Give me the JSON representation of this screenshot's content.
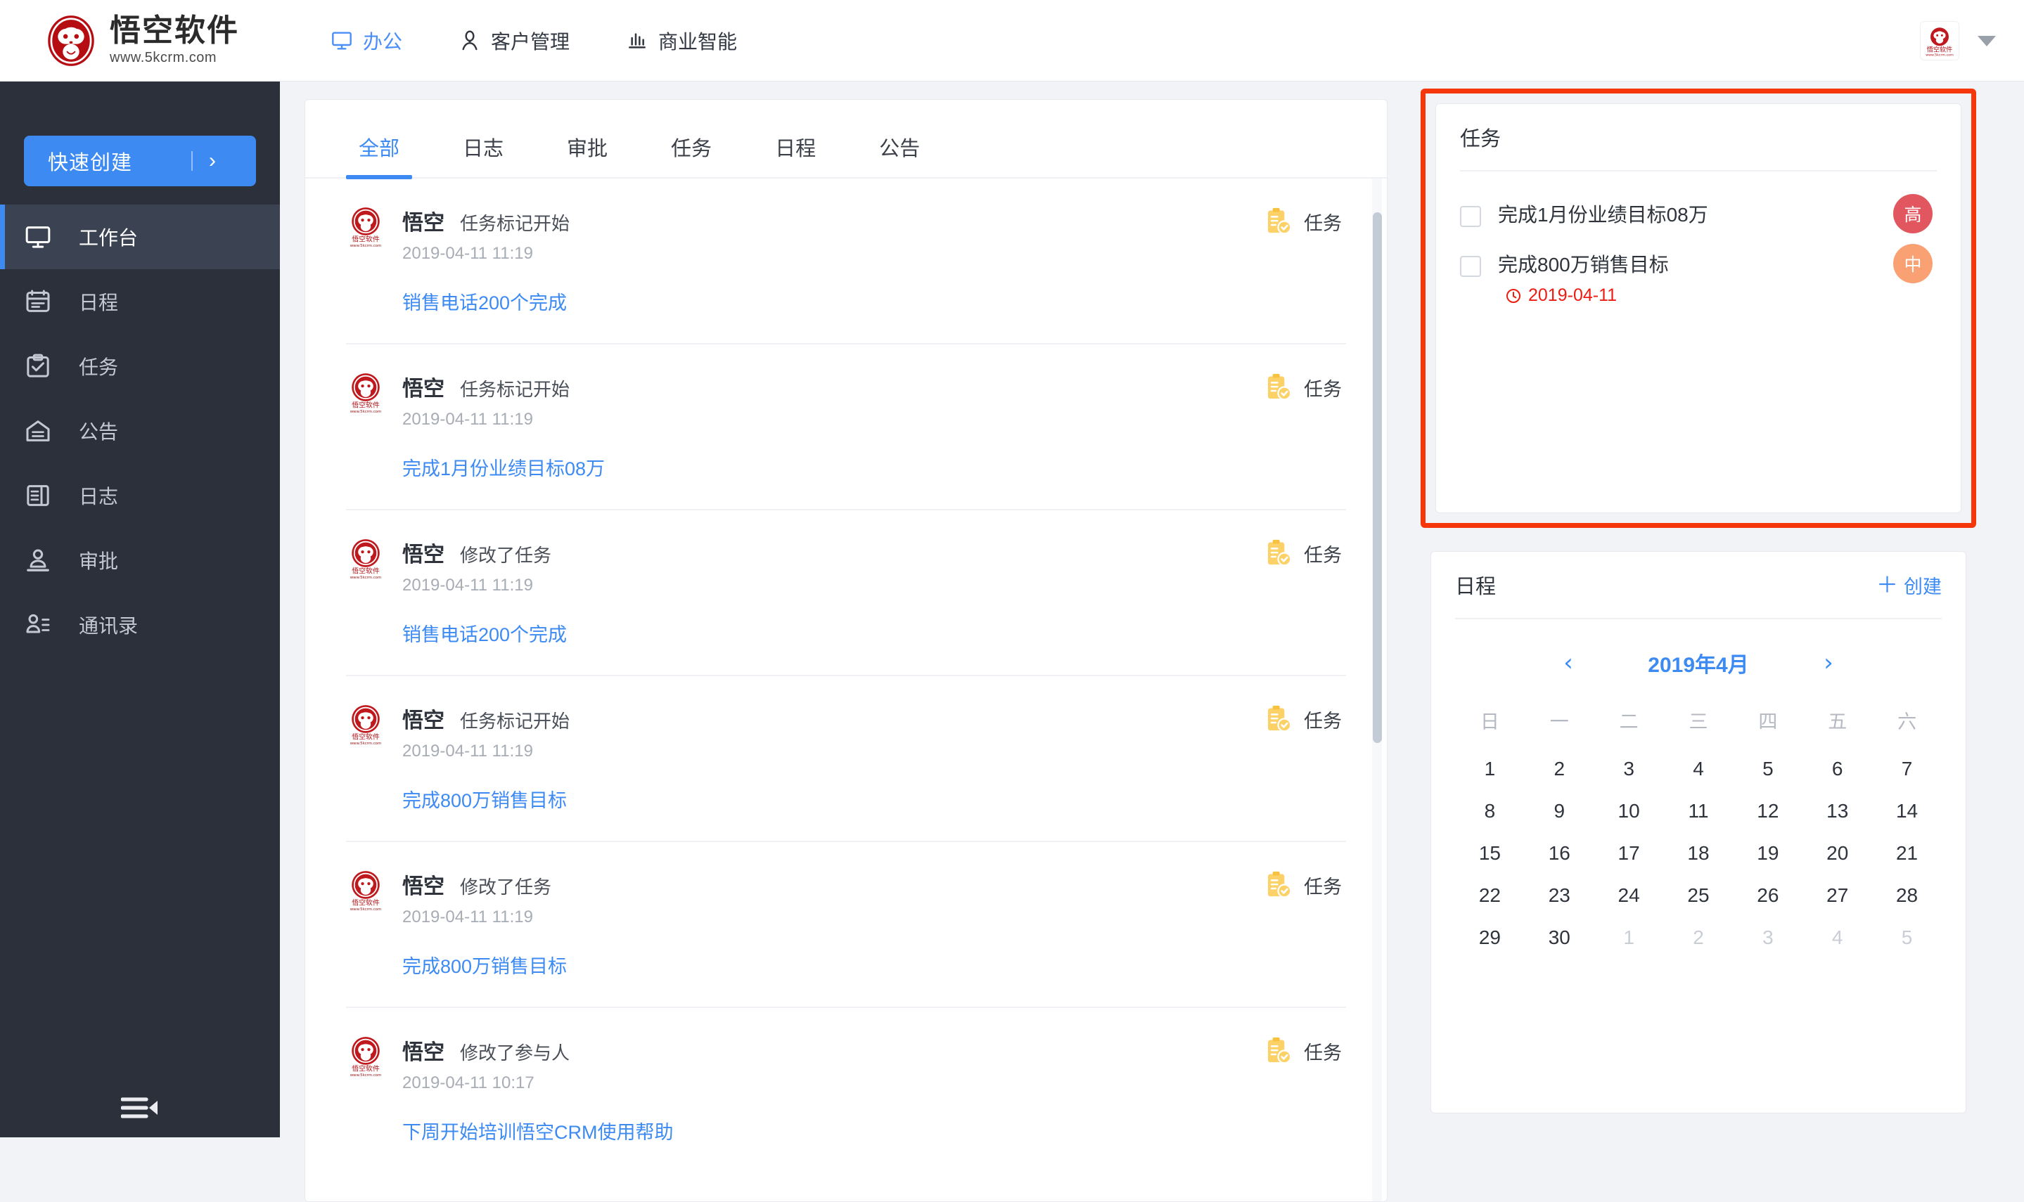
{
  "header": {
    "logo": {
      "title": "悟空软件",
      "subtitle": "www.5kcrm.com",
      "icon": "monkey-logo-icon"
    },
    "nav": [
      {
        "label": "办公",
        "icon": "monitor-icon",
        "active": true
      },
      {
        "label": "客户管理",
        "icon": "user-icon",
        "active": false
      },
      {
        "label": "商业智能",
        "icon": "bar-chart-icon",
        "active": false
      }
    ],
    "avatar_icon": "user-avatar-icon",
    "caret_icon": "chevron-down-icon"
  },
  "sidebar": {
    "quick_create": {
      "label": "快速创建",
      "arrow": "›"
    },
    "items": [
      {
        "label": "工作台",
        "icon": "workbench-icon",
        "active": true
      },
      {
        "label": "日程",
        "icon": "calendar-icon",
        "active": false
      },
      {
        "label": "任务",
        "icon": "task-icon",
        "active": false
      },
      {
        "label": "公告",
        "icon": "announcement-icon",
        "active": false
      },
      {
        "label": "日志",
        "icon": "journal-icon",
        "active": false
      },
      {
        "label": "审批",
        "icon": "approval-icon",
        "active": false
      },
      {
        "label": "通讯录",
        "icon": "contacts-icon",
        "active": false
      }
    ],
    "collapse_icon": "sidebar-collapse-icon"
  },
  "feed": {
    "tabs": [
      {
        "label": "全部",
        "active": true
      },
      {
        "label": "日志",
        "active": false
      },
      {
        "label": "审批",
        "active": false
      },
      {
        "label": "任务",
        "active": false
      },
      {
        "label": "日程",
        "active": false
      },
      {
        "label": "公告",
        "active": false
      }
    ],
    "items": [
      {
        "user": "悟空",
        "action": "任务标记开始",
        "time": "2019-04-11 11:19",
        "link": "销售电话200个完成",
        "tag": "任务",
        "tag_icon": "task-clipboard-icon"
      },
      {
        "user": "悟空",
        "action": "任务标记开始",
        "time": "2019-04-11 11:19",
        "link": "完成1月份业绩目标08万",
        "tag": "任务",
        "tag_icon": "task-clipboard-icon"
      },
      {
        "user": "悟空",
        "action": "修改了任务",
        "time": "2019-04-11 11:19",
        "link": "销售电话200个完成",
        "tag": "任务",
        "tag_icon": "task-clipboard-icon"
      },
      {
        "user": "悟空",
        "action": "任务标记开始",
        "time": "2019-04-11 11:19",
        "link": "完成800万销售目标",
        "tag": "任务",
        "tag_icon": "task-clipboard-icon"
      },
      {
        "user": "悟空",
        "action": "修改了任务",
        "time": "2019-04-11 11:19",
        "link": "完成800万销售目标",
        "tag": "任务",
        "tag_icon": "task-clipboard-icon"
      },
      {
        "user": "悟空",
        "action": "修改了参与人",
        "time": "2019-04-11 10:17",
        "link": "下周开始培训悟空CRM使用帮助",
        "tag": "任务",
        "tag_icon": "task-clipboard-icon"
      }
    ]
  },
  "task_panel": {
    "title": "任务",
    "highlight_color": "#f5370b",
    "tasks": [
      {
        "name": "完成1月份业绩目标08万",
        "due": null,
        "priority": "高",
        "priority_color": "#e2575f"
      },
      {
        "name": "完成800万销售目标",
        "due": "2019-04-11",
        "due_icon": "clock-icon",
        "priority": "中",
        "priority_color": "#f9a173"
      }
    ]
  },
  "calendar_panel": {
    "title": "日程",
    "create_label": "创建",
    "create_icon": "plus-icon",
    "prev_icon": "chevron-left-icon",
    "next_icon": "chevron-right-icon",
    "month_label": "2019年4月",
    "weekdays": [
      "日",
      "一",
      "二",
      "三",
      "四",
      "五",
      "六"
    ],
    "weeks": [
      [
        {
          "d": "1",
          "out": false
        },
        {
          "d": "2",
          "out": false
        },
        {
          "d": "3",
          "out": false
        },
        {
          "d": "4",
          "out": false
        },
        {
          "d": "5",
          "out": false
        },
        {
          "d": "6",
          "out": false
        },
        {
          "d": "7",
          "out": false
        }
      ],
      [
        {
          "d": "8",
          "out": false
        },
        {
          "d": "9",
          "out": false
        },
        {
          "d": "10",
          "out": false
        },
        {
          "d": "11",
          "out": false
        },
        {
          "d": "12",
          "out": false
        },
        {
          "d": "13",
          "out": false
        },
        {
          "d": "14",
          "out": false
        }
      ],
      [
        {
          "d": "15",
          "out": false
        },
        {
          "d": "16",
          "out": false
        },
        {
          "d": "17",
          "out": false
        },
        {
          "d": "18",
          "out": false
        },
        {
          "d": "19",
          "out": false
        },
        {
          "d": "20",
          "out": false
        },
        {
          "d": "21",
          "out": false
        }
      ],
      [
        {
          "d": "22",
          "out": false
        },
        {
          "d": "23",
          "out": false
        },
        {
          "d": "24",
          "out": false
        },
        {
          "d": "25",
          "out": false
        },
        {
          "d": "26",
          "out": false
        },
        {
          "d": "27",
          "out": false
        },
        {
          "d": "28",
          "out": false
        }
      ],
      [
        {
          "d": "29",
          "out": false
        },
        {
          "d": "30",
          "out": false
        },
        {
          "d": "1",
          "out": true
        },
        {
          "d": "2",
          "out": true
        },
        {
          "d": "3",
          "out": true
        },
        {
          "d": "4",
          "out": true
        },
        {
          "d": "5",
          "out": true
        }
      ]
    ]
  }
}
